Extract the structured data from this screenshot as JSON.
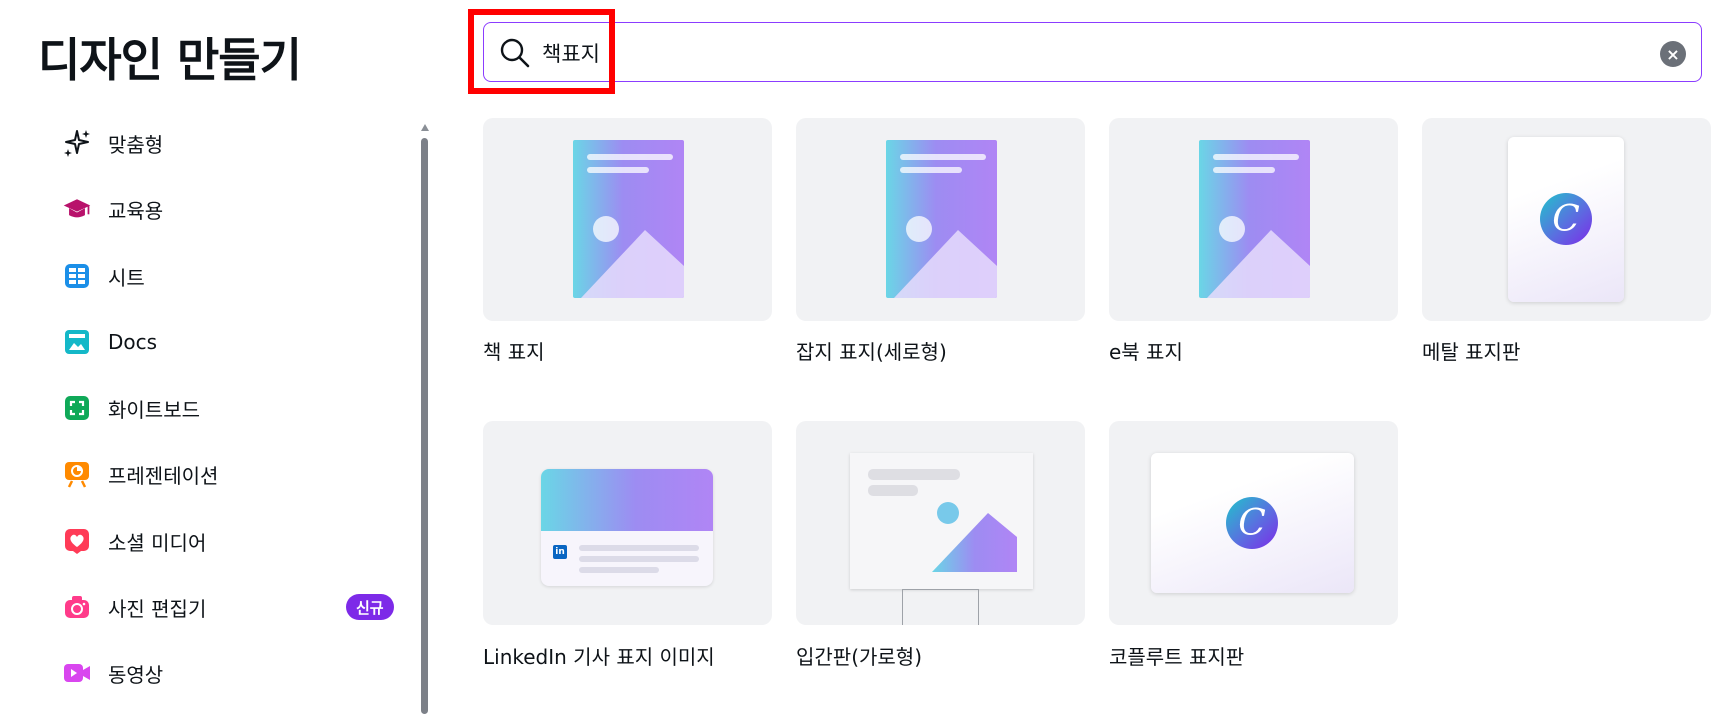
{
  "page": {
    "title": "디자인 만들기"
  },
  "search": {
    "value": "책표지",
    "clear_icon": "close-icon"
  },
  "sidebar": {
    "items": [
      {
        "label": "맞춤형",
        "icon": "sparkles-icon",
        "color": "#0e1318"
      },
      {
        "label": "교육용",
        "icon": "graduation-cap-icon",
        "color": "#b8126b"
      },
      {
        "label": "시트",
        "icon": "sheet-grid-icon",
        "color": "#1b8fe8"
      },
      {
        "label": "Docs",
        "icon": "docs-icon",
        "color": "#14b8c8"
      },
      {
        "label": "화이트보드",
        "icon": "whiteboard-icon",
        "color": "#0fa958"
      },
      {
        "label": "프레젠테이션",
        "icon": "presentation-icon",
        "color": "#ff8a00"
      },
      {
        "label": "소셜 미디어",
        "icon": "heart-icon",
        "color": "#ff3b57"
      },
      {
        "label": "사진 편집기",
        "icon": "camera-icon",
        "color": "#ff3b8a",
        "badge": "신규"
      },
      {
        "label": "동영상",
        "icon": "video-camera-icon",
        "color": "#d946ef"
      }
    ]
  },
  "results": [
    {
      "label": "책 표지"
    },
    {
      "label": "잡지 표지(세로형)"
    },
    {
      "label": "e북 표지"
    },
    {
      "label": "메탈 표지판"
    },
    {
      "label": "LinkedIn 기사 표지 이미지",
      "icon_text": "in"
    },
    {
      "label": "입간판(가로형)"
    },
    {
      "label": "코플루트 표지판"
    }
  ],
  "colors": {
    "accent": "#8b3dff",
    "badge": "#7d2ae8",
    "highlight": "#ff0000"
  }
}
